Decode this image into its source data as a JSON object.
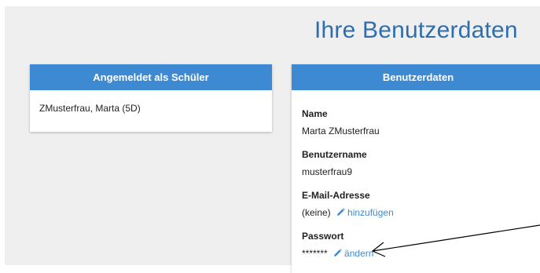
{
  "page": {
    "title": "Ihre Benutzerdaten"
  },
  "login_card": {
    "header": "Angemeldet als Schüler",
    "user": "ZMusterfrau, Marta (5D)"
  },
  "user_card": {
    "header": "Benutzerdaten",
    "name_label": "Name",
    "name_value": "Marta ZMusterfrau",
    "username_label": "Benutzername",
    "username_value": "musterfrau9",
    "email_label": "E-Mail-Adresse",
    "email_value": "(keine)",
    "email_action": "hinzufügen",
    "password_label": "Passwort",
    "password_value": "*******",
    "password_action": "ändern"
  },
  "colors": {
    "accent": "#3e8ad2",
    "title": "#2d6fae",
    "background": "#efefef"
  }
}
